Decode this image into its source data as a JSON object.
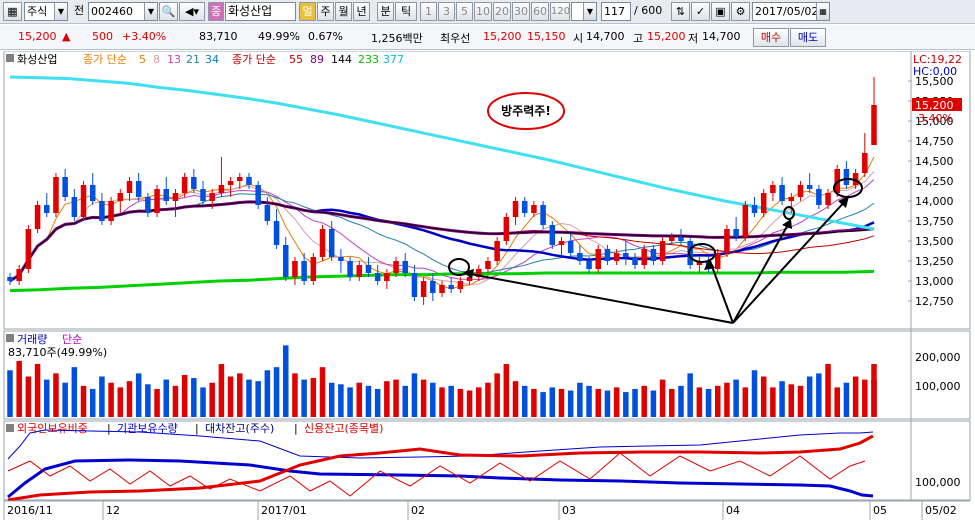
{
  "toolbar": {
    "market_type": "주식",
    "jeon_label": "전",
    "code": "002460",
    "company": "화성산업",
    "company_tag": "종",
    "period_tag": "멀",
    "periods": [
      "주",
      "월",
      "년",
      "분",
      "틱"
    ],
    "nums": [
      "1",
      "3",
      "5",
      "10",
      "20",
      "30",
      "60",
      "120"
    ],
    "count": "117",
    "count_total": "/ 600",
    "date": "2017/05/02"
  },
  "quote": {
    "price": "15,200",
    "change": "500",
    "change_pct": "+3.40%",
    "volume": "83,710",
    "vol_ratio": "49.99%",
    "turnover": "0.67%",
    "amount": "1,256백만",
    "best_label": "최우선",
    "best_ask": "15,200",
    "best_bid": "15,150",
    "open_label": "시",
    "open": "14,700",
    "high_label": "고",
    "high": "15,200",
    "low_label": "저",
    "low": "14,700",
    "buy_label": "매수",
    "sell_label": "매도"
  },
  "price_panel": {
    "title": "화성산업",
    "ma1_label": "종가 단순",
    "ma1_periods": [
      "5",
      "8",
      "13",
      "21",
      "34"
    ],
    "ma1_colors": [
      "#e67e00",
      "#d6a0a0",
      "#c040c0",
      "#2080a0",
      "#0080c0"
    ],
    "ma2_label": "종가 단순",
    "ma2_periods": [
      "55",
      "89",
      "144",
      "233",
      "377"
    ],
    "ma2_colors": [
      "#c00000",
      "#800080",
      "#000000",
      "#00c000",
      "#00c0d0"
    ],
    "lc_label": "LC:19,22",
    "hc_label": "HC:0,00",
    "yticks": [
      "15,500",
      "15,250",
      "15,000",
      "14,750",
      "14,500",
      "14,250",
      "14,000",
      "13,750",
      "13,500",
      "13,250",
      "13,000",
      "12,750"
    ],
    "last_price": "15,200",
    "last_pct": "3.40%",
    "annotation": "방주력주!"
  },
  "volume_panel": {
    "title": "거래량",
    "subtitle": "단순",
    "current": "83,710주(49.99%)",
    "yticks": [
      "200,000",
      "100,000"
    ]
  },
  "investor_panel": {
    "legend": [
      "외국인보유비중",
      "기관보유수량",
      "대차잔고(주수)",
      "신용잔고(종목별)"
    ],
    "legend_colors": [
      "#e00000",
      "#0000d0",
      "#000080",
      "#e00000"
    ],
    "ytick": "100,000"
  },
  "xaxis": {
    "labels": [
      "2016/11",
      "12",
      "2017/01",
      "02",
      "03",
      "04",
      "05",
      "05/02"
    ]
  },
  "chart_data": {
    "type": "candlestick",
    "candles": [
      [
        13050,
        13100,
        12950,
        13000
      ],
      [
        13000,
        13200,
        12950,
        13150
      ],
      [
        13150,
        13700,
        13100,
        13650
      ],
      [
        13650,
        14000,
        13600,
        13950
      ],
      [
        13950,
        14100,
        13800,
        13850
      ],
      [
        13850,
        14350,
        13800,
        14300
      ],
      [
        14300,
        14400,
        14000,
        14050
      ],
      [
        14050,
        14150,
        13750,
        13800
      ],
      [
        13800,
        14250,
        13750,
        14200
      ],
      [
        14200,
        14350,
        13950,
        14000
      ],
      [
        14000,
        14100,
        13700,
        13750
      ],
      [
        13750,
        14050,
        13700,
        14000
      ],
      [
        14000,
        14150,
        13850,
        14100
      ],
      [
        14100,
        14300,
        14000,
        14250
      ],
      [
        14250,
        14350,
        14000,
        14050
      ],
      [
        14050,
        14100,
        13800,
        13850
      ],
      [
        13850,
        14200,
        13800,
        14150
      ],
      [
        14150,
        14300,
        13950,
        14000
      ],
      [
        14000,
        14150,
        13800,
        14100
      ],
      [
        14100,
        14350,
        14050,
        14300
      ],
      [
        14300,
        14400,
        14100,
        14150
      ],
      [
        14150,
        14250,
        13950,
        14000
      ],
      [
        14000,
        14150,
        13900,
        14100
      ],
      [
        14100,
        14550,
        14050,
        14200
      ],
      [
        14200,
        14300,
        14050,
        14250
      ],
      [
        14250,
        14350,
        14150,
        14300
      ],
      [
        14300,
        14350,
        14150,
        14200
      ],
      [
        14200,
        14250,
        13900,
        13950
      ],
      [
        13950,
        14050,
        13700,
        13750
      ],
      [
        13750,
        13900,
        13400,
        13450
      ],
      [
        13450,
        13550,
        13000,
        13050
      ],
      [
        13050,
        13300,
        12950,
        13250
      ],
      [
        13250,
        13350,
        12950,
        13000
      ],
      [
        13000,
        13350,
        12950,
        13300
      ],
      [
        13300,
        13700,
        13250,
        13650
      ],
      [
        13650,
        13750,
        13250,
        13300
      ],
      [
        13300,
        13400,
        13100,
        13250
      ],
      [
        13250,
        13300,
        13000,
        13050
      ],
      [
        13050,
        13250,
        13000,
        13200
      ],
      [
        13200,
        13300,
        13050,
        13100
      ],
      [
        13100,
        13200,
        12950,
        13000
      ],
      [
        13000,
        13150,
        12900,
        13100
      ],
      [
        13100,
        13300,
        13050,
        13250
      ],
      [
        13250,
        13350,
        13050,
        13100
      ],
      [
        13100,
        13200,
        12750,
        12800
      ],
      [
        12800,
        13050,
        12700,
        13000
      ],
      [
        13000,
        13100,
        12750,
        12850
      ],
      [
        12850,
        13000,
        12800,
        12950
      ],
      [
        12950,
        13050,
        12850,
        12900
      ],
      [
        12900,
        13050,
        12850,
        13000
      ],
      [
        13000,
        13100,
        12950,
        13050
      ],
      [
        13050,
        13200,
        13000,
        13150
      ],
      [
        13150,
        13300,
        13100,
        13250
      ],
      [
        13250,
        13550,
        13200,
        13500
      ],
      [
        13500,
        13850,
        13450,
        13800
      ],
      [
        13800,
        14050,
        13700,
        14000
      ],
      [
        14000,
        14050,
        13800,
        13850
      ],
      [
        13850,
        14000,
        13800,
        13950
      ],
      [
        13950,
        14000,
        13650,
        13700
      ],
      [
        13700,
        13750,
        13400,
        13450
      ],
      [
        13450,
        13550,
        13300,
        13500
      ],
      [
        13500,
        13600,
        13300,
        13350
      ],
      [
        13350,
        13450,
        13200,
        13250
      ],
      [
        13250,
        13300,
        13100,
        13150
      ],
      [
        13150,
        13450,
        13100,
        13400
      ],
      [
        13400,
        13450,
        13200,
        13250
      ],
      [
        13250,
        13400,
        13200,
        13350
      ],
      [
        13350,
        13500,
        13200,
        13300
      ],
      [
        13300,
        13350,
        13150,
        13200
      ],
      [
        13200,
        13450,
        13150,
        13400
      ],
      [
        13400,
        13450,
        13200,
        13250
      ],
      [
        13250,
        13550,
        13200,
        13500
      ],
      [
        13500,
        13600,
        13450,
        13550
      ],
      [
        13550,
        13650,
        13450,
        13500
      ],
      [
        13500,
        13550,
        13150,
        13200
      ],
      [
        13200,
        13300,
        13100,
        13250
      ],
      [
        13250,
        13300,
        13100,
        13150
      ],
      [
        13150,
        13400,
        13100,
        13350
      ],
      [
        13350,
        13700,
        13300,
        13650
      ],
      [
        13650,
        13800,
        13500,
        13550
      ],
      [
        13550,
        14000,
        13500,
        13950
      ],
      [
        13950,
        14050,
        13800,
        13850
      ],
      [
        13850,
        14150,
        13800,
        14100
      ],
      [
        14100,
        14250,
        14000,
        14200
      ],
      [
        14200,
        14300,
        13950,
        14000
      ],
      [
        14000,
        14100,
        13850,
        14050
      ],
      [
        14050,
        14250,
        14000,
        14200
      ],
      [
        14200,
        14350,
        14100,
        14150
      ],
      [
        14150,
        14200,
        13900,
        13950
      ],
      [
        13950,
        14150,
        13900,
        14100
      ],
      [
        14100,
        14450,
        14050,
        14400
      ],
      [
        14400,
        14500,
        14150,
        14200
      ],
      [
        14200,
        14400,
        14150,
        14350
      ],
      [
        14350,
        14850,
        14300,
        14600
      ],
      [
        14700,
        15550,
        14700,
        15200
      ]
    ],
    "ma_series": [
      {
        "name": "233",
        "values": [
          12880,
          12890,
          12910,
          12920,
          12940,
          12960,
          12980,
          13000,
          13010,
          13030,
          13050,
          13060,
          13070,
          13080,
          13080,
          13090,
          13090,
          13090,
          13100,
          13100,
          13100,
          13100,
          13100,
          13100,
          13100,
          13100,
          13110,
          13110,
          13110,
          13120
        ]
      },
      {
        "name": "377",
        "values": [
          15550,
          15540,
          15530,
          15500,
          15470,
          15420,
          15380,
          15330,
          15280,
          15220,
          15150,
          15080,
          15000,
          14920,
          14840,
          14760,
          14680,
          14600,
          14520,
          14430,
          14340,
          14250,
          14160,
          14080,
          14000,
          13930,
          13860,
          13790,
          13720,
          13650
        ]
      }
    ],
    "volume": [
      150,
      180,
      130,
      170,
      120,
      140,
      110,
      160,
      100,
      90,
      130,
      110,
      95,
      115,
      140,
      105,
      90,
      120,
      100,
      135,
      125,
      95,
      110,
      170,
      130,
      140,
      120,
      115,
      150,
      160,
      230,
      140,
      120,
      125,
      160,
      110,
      105,
      95,
      110,
      100,
      90,
      115,
      120,
      100,
      140,
      120,
      110,
      95,
      100,
      90,
      85,
      95,
      110,
      140,
      170,
      115,
      100,
      90,
      80,
      95,
      90,
      85,
      110,
      100,
      90,
      85,
      95,
      80,
      90,
      100,
      85,
      120,
      90,
      100,
      140,
      95,
      90,
      100,
      110,
      120,
      95,
      150,
      130,
      95,
      115,
      105,
      100,
      130,
      140,
      170,
      95,
      110,
      130,
      120,
      170,
      120
    ],
    "ylim": [
      12500,
      15650
    ],
    "vol_ylim": [
      0,
      260000
    ]
  }
}
